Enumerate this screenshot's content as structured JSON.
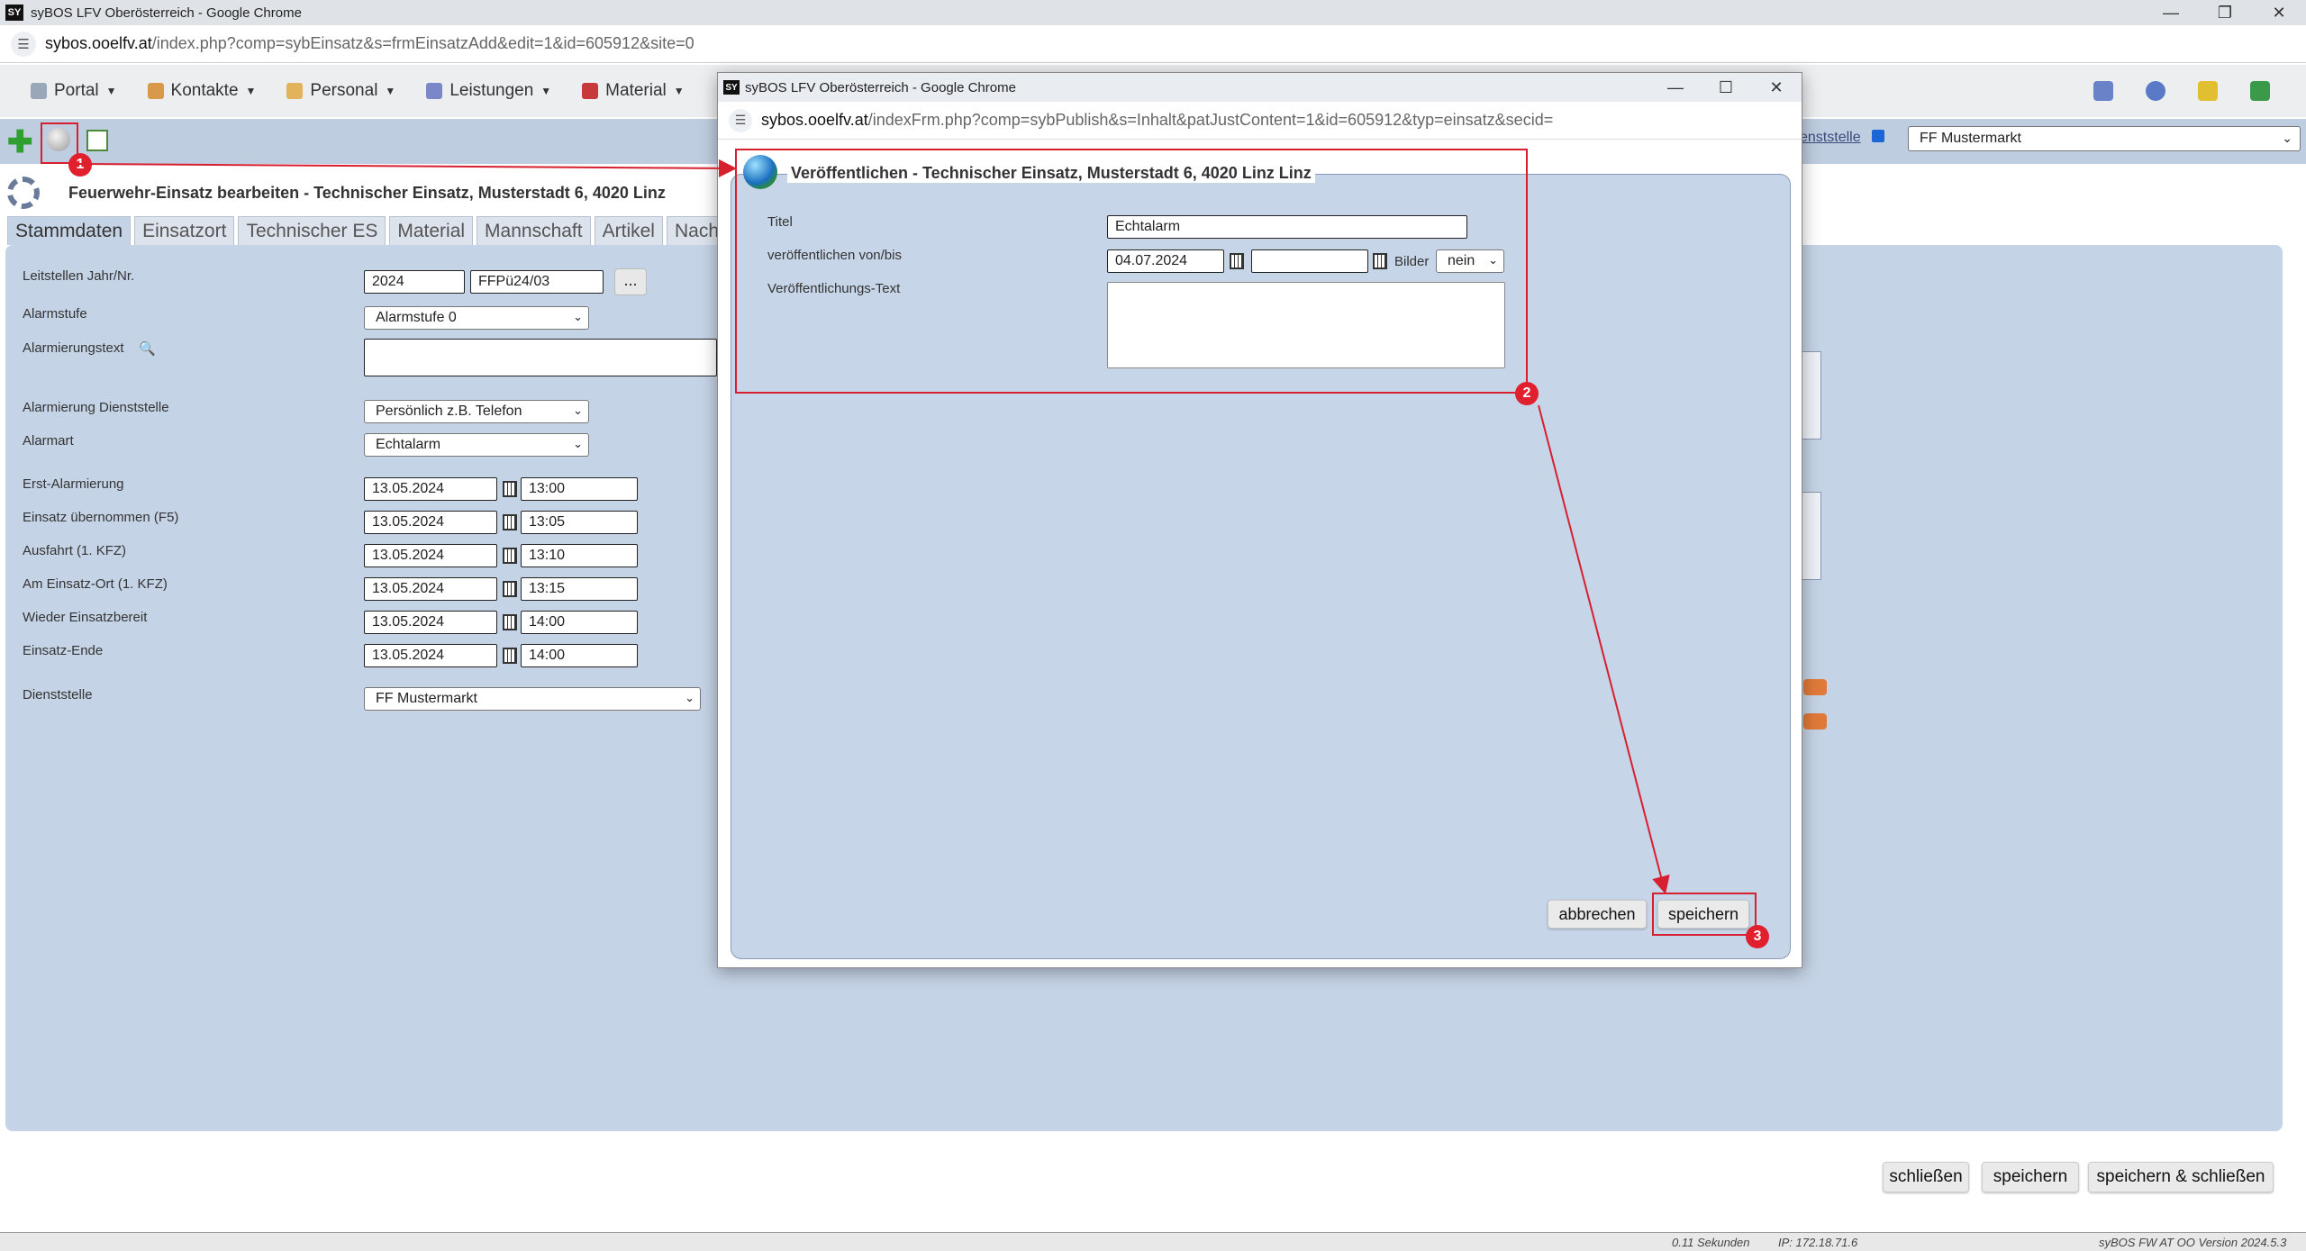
{
  "window": {
    "title": "syBOS LFV Oberösterreich - Google Chrome",
    "url_domain": "sybos.ooelfv.at",
    "url_path": "/index.php?comp=sybEinsatz&s=frmEinsatzAdd&edit=1&id=605912&site=0"
  },
  "nav": {
    "items": [
      "Portal",
      "Kontakte",
      "Personal",
      "Leistungen",
      "Material"
    ]
  },
  "toolbar": {
    "dienststelle_label": "enststelle",
    "dienststelle_value": "FF Mustermarkt"
  },
  "page": {
    "title": "Feuerwehr-Einsatz bearbeiten - Technischer Einsatz, Musterstadt 6, 4020 Linz",
    "tabs": [
      "Stammdaten",
      "Einsatzort",
      "Technischer ES",
      "Material",
      "Mannschaft",
      "Artikel",
      "Nachb"
    ]
  },
  "form": {
    "leitstellen_label": "Leitstellen Jahr/Nr.",
    "leitstellen_year": "2024",
    "leitstellen_nr": "FFPü24/03",
    "dots": "...",
    "alarmstufe_label": "Alarmstufe",
    "alarmstufe_value": "Alarmstufe 0",
    "alarmierungstext_label": "Alarmierungstext",
    "alarmierung_ds_label": "Alarmierung Dienststelle",
    "alarmierung_ds_value": "Persönlich z.B. Telefon",
    "alarmart_label": "Alarmart",
    "alarmart_value": "Echtalarm",
    "times": [
      {
        "label": "Erst-Alarmierung",
        "date": "13.05.2024",
        "time": "13:00"
      },
      {
        "label": "Einsatz übernommen (F5)",
        "date": "13.05.2024",
        "time": "13:05"
      },
      {
        "label": "Ausfahrt (1. KFZ)",
        "date": "13.05.2024",
        "time": "13:10"
      },
      {
        "label": "Am Einsatz-Ort (1. KFZ)",
        "date": "13.05.2024",
        "time": "13:15"
      },
      {
        "label": "Wieder Einsatzbereit",
        "date": "13.05.2024",
        "time": "14:00"
      },
      {
        "label": "Einsatz-Ende",
        "date": "13.05.2024",
        "time": "14:00"
      }
    ],
    "dienststelle_label": "Dienststelle",
    "dienststelle_value": "FF Mustermarkt"
  },
  "footer_buttons": {
    "close": "schließen",
    "save": "speichern",
    "save_close": "speichern & schließen"
  },
  "statusbar": {
    "time": "0.11 Sekunden",
    "ip": "IP: 172.18.71.6",
    "version": "syBOS FW AT OO Version 2024.5.3"
  },
  "popup": {
    "title": "syBOS LFV Oberösterreich - Google Chrome",
    "url_domain": "sybos.ooelfv.at",
    "url_path": "/indexFrm.php?comp=sybPublish&s=Inhalt&patJustContent=1&id=605912&typ=einsatz&secid=",
    "heading": "Veröffentlichen - Technischer Einsatz, Musterstadt 6, 4020 Linz Linz",
    "titel_label": "Titel",
    "titel_value": "Echtalarm",
    "von_bis_label": "veröffentlichen von/bis",
    "von_value": "04.07.2024",
    "bis_value": "",
    "bilder_label": "Bilder",
    "bilder_value": "nein",
    "text_label": "Veröffentlichungs-Text",
    "text_value": "",
    "cancel": "abbrechen",
    "save": "speichern"
  },
  "annotations": {
    "badges": [
      "1",
      "2",
      "3"
    ],
    "color": "#e0202c"
  },
  "colors": {
    "panel": "#c5d3e6",
    "toolbar": "#bfcde0",
    "popup_content": "#c7d5e8"
  }
}
